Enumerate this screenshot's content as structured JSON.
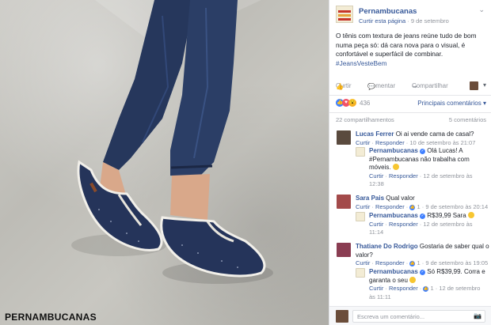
{
  "photo": {
    "watermark": "PERNAMBUCANAS"
  },
  "post": {
    "page_name": "Pernambucanas",
    "like_page": "Curtir esta página",
    "separator": " · ",
    "date": "9 de setembro",
    "chevron": "⌄",
    "text": "O tênis com textura de jeans reúne tudo de bom numa peça só: dá cara nova para o visual, é confortável e superfácil de combinar.",
    "hashtag": "#JeansVesteBem"
  },
  "actions": {
    "like": "Curtir",
    "comment": "Comentar",
    "share": "Compartilhar",
    "like_icon": "👍",
    "comment_icon": "💬",
    "share_icon": "↪"
  },
  "reactions": {
    "count": "436",
    "sort_label": "Principais comentários ▾",
    "like_glyph": "👍",
    "love_glyph": "♥",
    "wow_glyph": "😮"
  },
  "counts": {
    "shares": "22 compartilhamentos",
    "comments": "5 comentários"
  },
  "comments": [
    {
      "name": "Lucas Ferrer",
      "text": "Oi ai vende cama de casal?",
      "like": "Curtir",
      "reply": "Responder",
      "time": "10 de setembro às 21:07",
      "reply_item": {
        "name": "Pernambucanas",
        "text_1": "Olá Lucas! A",
        "text_2": "#Pernambucanas não trabalha com",
        "text_3": "móveis.",
        "like": "Curtir",
        "reply": "Responder",
        "time_1": "12 de setembro às",
        "time_2": "12:38"
      }
    },
    {
      "name": "Sara Pais",
      "text": "Qual valor",
      "like": "Curtir",
      "reply": "Responder",
      "likes": "1",
      "time": "9 de setembro às 20:14",
      "reply_item": {
        "name": "Pernambucanas",
        "text_1": "R$39,99 Sara",
        "like": "Curtir",
        "reply": "Responder",
        "time_1": "12 de setembro às",
        "time_2": "11:14"
      }
    },
    {
      "name": "Thatiane Do Rodrigo",
      "text_1": "Gostaria de saber qual o",
      "text_2": "valor?",
      "like": "Curtir",
      "reply": "Responder",
      "likes": "1",
      "time": "9 de setembro às 19:05",
      "reply_item": {
        "name": "Pernambucanas",
        "text_1": "Só R$39,99. Corra e",
        "text_2": "garanta o seu",
        "like": "Curtir",
        "reply": "Responder",
        "likes": "1",
        "time_1": "12 de setembro",
        "time_2": "às 11:11"
      }
    }
  ],
  "write_comment": {
    "placeholder": "Escreva um comentário...",
    "camera_icon": "📷"
  },
  "colors": {
    "link": "#365899",
    "meta": "#90949c",
    "denim": "#26375c"
  }
}
